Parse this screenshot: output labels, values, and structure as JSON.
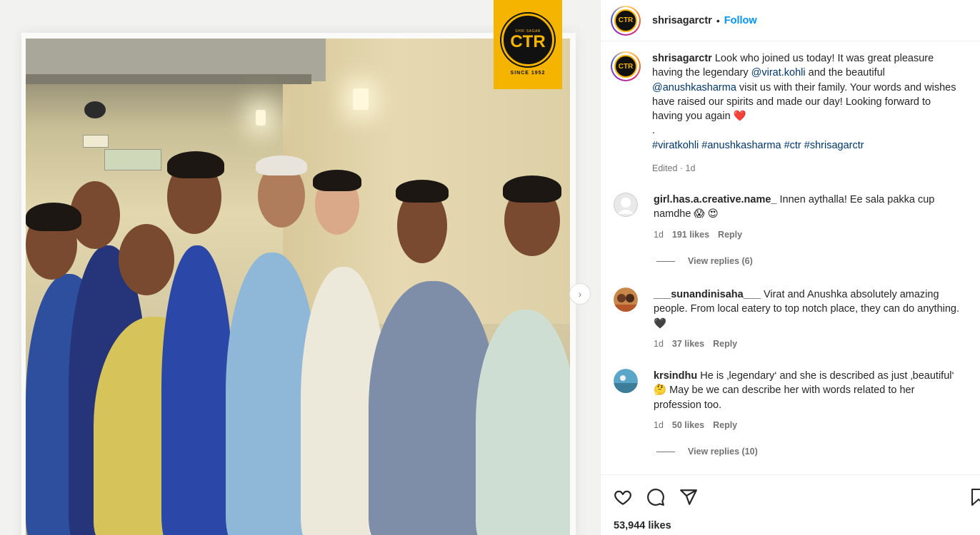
{
  "post": {
    "username": "shrisagarctr",
    "separator": "•",
    "follow_label": "Follow",
    "avatar_text": "CTR"
  },
  "logo": {
    "top_text": "SHRI SAGAR",
    "main_text": "CTR",
    "since_text": "SINCE 1952"
  },
  "caption": {
    "username": "shrisagarctr",
    "text_1": " Look who joined us today! It was great pleasure having the legendary ",
    "mention_1": "@virat.kohli",
    "text_2": " and the beautiful ",
    "mention_2": "@anushkasharma",
    "text_3": " visit us with their family. Your words and wishes have raised our spirits and made our day! Looking forward to having you again ",
    "heart": "❤️",
    "dot": ".",
    "hashtags": "#viratkohli #anushkasharma #ctr #shrisagarctr",
    "meta": "Edited · 1d"
  },
  "comments": [
    {
      "username": "girl.has.a.creative.name_",
      "text": " Innen aythalla! Ee sala pakka cup namdhe 😱 😍",
      "time": "1d",
      "likes": "191 likes",
      "reply_label": "Reply",
      "view_replies": "View replies (6)"
    },
    {
      "username": "___sunandinisaha___",
      "text": " Virat and Anushka absolutely amazing people. From local eatery to top notch place, they can do anything. 🖤",
      "time": "1d",
      "likes": "37 likes",
      "reply_label": "Reply"
    },
    {
      "username": "krsindhu",
      "text": " He is ‚legendary‘ and she is described as just ‚beautiful‘ 🤔  May be we can describe her with words related to her profession too.",
      "time": "1d",
      "likes": "50 likes",
      "reply_label": "Reply",
      "view_replies": "View replies (10)"
    }
  ],
  "actions": {
    "likes_count": "53,944 likes",
    "icons": [
      "heart-icon",
      "comment-icon",
      "share-icon",
      "bookmark-icon"
    ]
  },
  "colors": {
    "accent": "#0095f6",
    "link": "#00376b",
    "muted": "#737373",
    "brand_yellow": "#f4b400"
  }
}
